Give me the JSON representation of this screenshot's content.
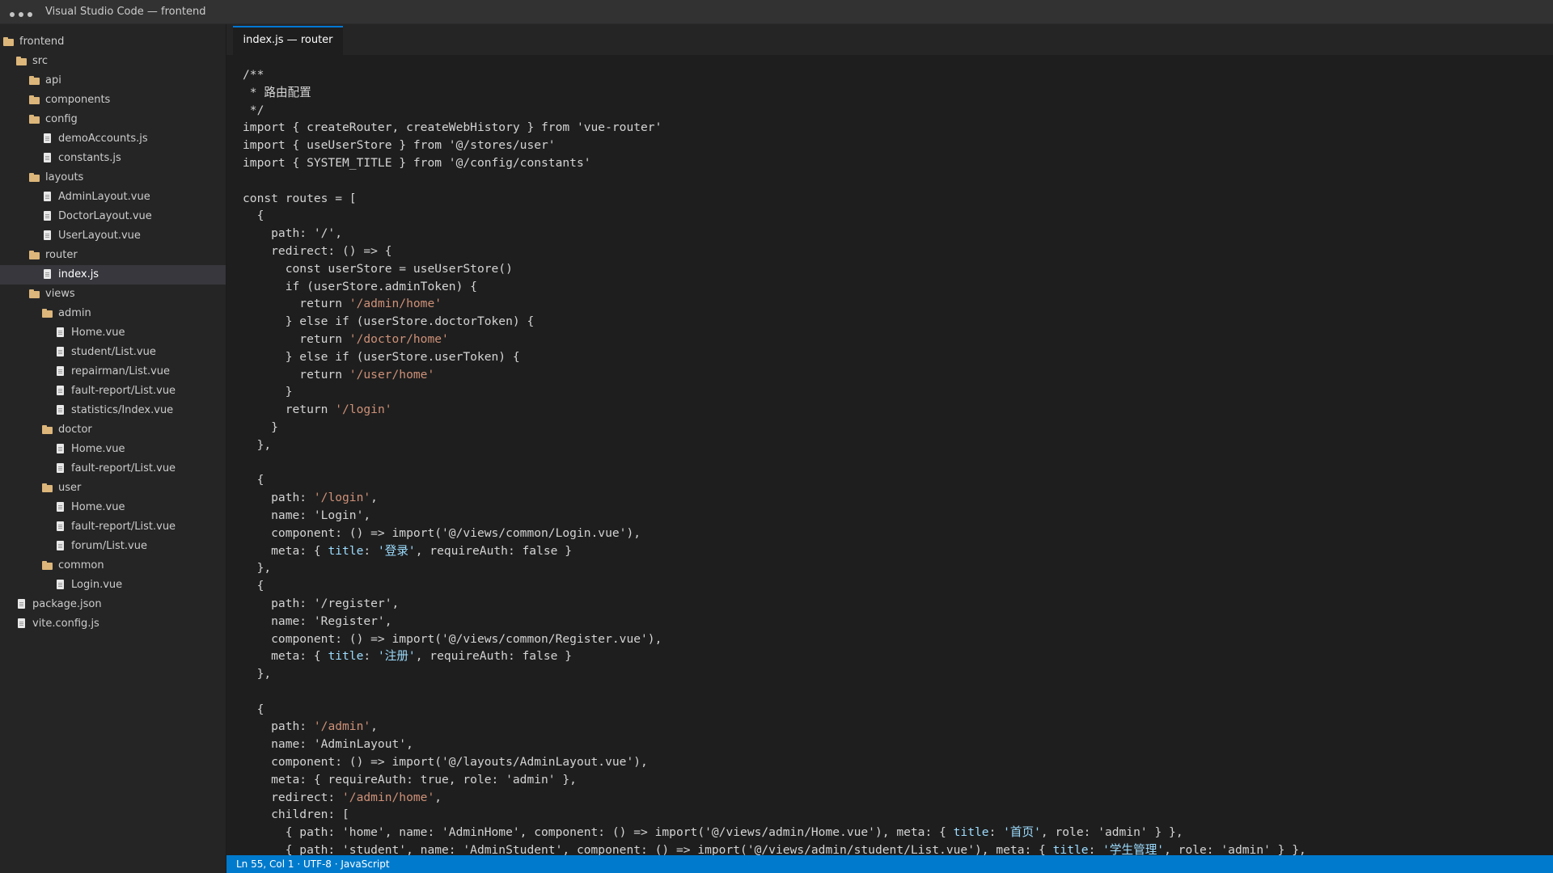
{
  "window": {
    "title": "Visual Studio Code — frontend"
  },
  "explorer": [
    {
      "label": "frontend",
      "type": "folder",
      "depth": 0,
      "active": false
    },
    {
      "label": "src",
      "type": "folder",
      "depth": 1,
      "active": false
    },
    {
      "label": "api",
      "type": "folder",
      "depth": 2,
      "active": false
    },
    {
      "label": "components",
      "type": "folder",
      "depth": 2,
      "active": false
    },
    {
      "label": "config",
      "type": "folder",
      "depth": 2,
      "active": false
    },
    {
      "label": "demoAccounts.js",
      "type": "file",
      "depth": 3,
      "active": false
    },
    {
      "label": "constants.js",
      "type": "file",
      "depth": 3,
      "active": false
    },
    {
      "label": "layouts",
      "type": "folder",
      "depth": 2,
      "active": false
    },
    {
      "label": "AdminLayout.vue",
      "type": "file",
      "depth": 3,
      "active": false
    },
    {
      "label": "DoctorLayout.vue",
      "type": "file",
      "depth": 3,
      "active": false
    },
    {
      "label": "UserLayout.vue",
      "type": "file",
      "depth": 3,
      "active": false
    },
    {
      "label": "router",
      "type": "folder",
      "depth": 2,
      "active": false
    },
    {
      "label": "index.js",
      "type": "file",
      "depth": 3,
      "active": true
    },
    {
      "label": "views",
      "type": "folder",
      "depth": 2,
      "active": false
    },
    {
      "label": "admin",
      "type": "folder",
      "depth": 3,
      "active": false
    },
    {
      "label": "Home.vue",
      "type": "file",
      "depth": 4,
      "active": false
    },
    {
      "label": "student/List.vue",
      "type": "file",
      "depth": 4,
      "active": false
    },
    {
      "label": "repairman/List.vue",
      "type": "file",
      "depth": 4,
      "active": false
    },
    {
      "label": "fault-report/List.vue",
      "type": "file",
      "depth": 4,
      "active": false
    },
    {
      "label": "statistics/Index.vue",
      "type": "file",
      "depth": 4,
      "active": false
    },
    {
      "label": "doctor",
      "type": "folder",
      "depth": 3,
      "active": false
    },
    {
      "label": "Home.vue",
      "type": "file",
      "depth": 4,
      "active": false
    },
    {
      "label": "fault-report/List.vue",
      "type": "file",
      "depth": 4,
      "active": false
    },
    {
      "label": "user",
      "type": "folder",
      "depth": 3,
      "active": false
    },
    {
      "label": "Home.vue",
      "type": "file",
      "depth": 4,
      "active": false
    },
    {
      "label": "fault-report/List.vue",
      "type": "file",
      "depth": 4,
      "active": false
    },
    {
      "label": "forum/List.vue",
      "type": "file",
      "depth": 4,
      "active": false
    },
    {
      "label": "common",
      "type": "folder",
      "depth": 3,
      "active": false
    },
    {
      "label": "Login.vue",
      "type": "file",
      "depth": 4,
      "active": false
    },
    {
      "label": "package.json",
      "type": "file",
      "depth": 1,
      "active": false
    },
    {
      "label": "vite.config.js",
      "type": "file",
      "depth": 1,
      "active": false
    }
  ],
  "tab": {
    "label": "index.js — router"
  },
  "colors": {
    "string": "#ce9178",
    "property": "#9cdcfe",
    "accent": "#0078d4",
    "statusbar": "#007acc"
  },
  "code_lines": [
    [
      {
        "t": "/**"
      }
    ],
    [
      {
        "t": " * 路由配置"
      }
    ],
    [
      {
        "t": " */"
      }
    ],
    [
      {
        "t": "import { createRouter, createWebHistory } from 'vue-router'"
      }
    ],
    [
      {
        "t": "import { useUserStore } from '@/stores/user'"
      }
    ],
    [
      {
        "t": "import { SYSTEM_TITLE } from '@/config/constants'"
      }
    ],
    [
      {
        "t": ""
      }
    ],
    [
      {
        "t": "const routes = ["
      }
    ],
    [
      {
        "t": "  {"
      }
    ],
    [
      {
        "t": "    path: '/',"
      }
    ],
    [
      {
        "t": "    redirect: () => {"
      }
    ],
    [
      {
        "t": "      const userStore = useUserStore()"
      }
    ],
    [
      {
        "t": "      if (userStore.adminToken) {"
      }
    ],
    [
      {
        "t": "        return "
      },
      {
        "t": "'/admin/home'",
        "c": "str"
      }
    ],
    [
      {
        "t": "      } else if (userStore.doctorToken) {"
      }
    ],
    [
      {
        "t": "        return "
      },
      {
        "t": "'/doctor/home'",
        "c": "str"
      }
    ],
    [
      {
        "t": "      } else if (userStore.userToken) {"
      }
    ],
    [
      {
        "t": "        return "
      },
      {
        "t": "'/user/home'",
        "c": "str"
      }
    ],
    [
      {
        "t": "      }"
      }
    ],
    [
      {
        "t": "      return "
      },
      {
        "t": "'/login'",
        "c": "str"
      }
    ],
    [
      {
        "t": "    }"
      }
    ],
    [
      {
        "t": "  },"
      }
    ],
    [
      {
        "t": ""
      }
    ],
    [
      {
        "t": "  {"
      }
    ],
    [
      {
        "t": "    path: "
      },
      {
        "t": "'/login'",
        "c": "str"
      },
      {
        "t": ","
      }
    ],
    [
      {
        "t": "    name: 'Login',"
      }
    ],
    [
      {
        "t": "    component: () => import('@/views/common/Login.vue'),"
      }
    ],
    [
      {
        "t": "    meta: { "
      },
      {
        "t": "title",
        "c": "blue"
      },
      {
        "t": ": "
      },
      {
        "t": "'登录'",
        "c": "blue"
      },
      {
        "t": ", requireAuth: false }"
      }
    ],
    [
      {
        "t": "  },"
      }
    ],
    [
      {
        "t": "  {"
      }
    ],
    [
      {
        "t": "    path: '/register',"
      }
    ],
    [
      {
        "t": "    name: 'Register',"
      }
    ],
    [
      {
        "t": "    component: () => import('@/views/common/Register.vue'),"
      }
    ],
    [
      {
        "t": "    meta: { "
      },
      {
        "t": "title",
        "c": "blue"
      },
      {
        "t": ": "
      },
      {
        "t": "'注册'",
        "c": "blue"
      },
      {
        "t": ", requireAuth: false }"
      }
    ],
    [
      {
        "t": "  },"
      }
    ],
    [
      {
        "t": ""
      }
    ],
    [
      {
        "t": "  {"
      }
    ],
    [
      {
        "t": "    path: "
      },
      {
        "t": "'/admin'",
        "c": "str"
      },
      {
        "t": ","
      }
    ],
    [
      {
        "t": "    name: 'AdminLayout',"
      }
    ],
    [
      {
        "t": "    component: () => import('@/layouts/AdminLayout.vue'),"
      }
    ],
    [
      {
        "t": "    meta: { requireAuth: true, role: 'admin' },"
      }
    ],
    [
      {
        "t": "    redirect: "
      },
      {
        "t": "'/admin/home'",
        "c": "str"
      },
      {
        "t": ","
      }
    ],
    [
      {
        "t": "    children: ["
      }
    ],
    [
      {
        "t": "      { path: 'home', name: 'AdminHome', component: () => import('@/views/admin/Home.vue'), meta: { "
      },
      {
        "t": "title",
        "c": "blue"
      },
      {
        "t": ": "
      },
      {
        "t": "'首页'",
        "c": "blue"
      },
      {
        "t": ", role: 'admin' } },"
      }
    ],
    [
      {
        "t": "      { path: 'student', name: 'AdminStudent', component: () => import('@/views/admin/student/List.vue'), meta: { "
      },
      {
        "t": "title",
        "c": "blue"
      },
      {
        "t": ": "
      },
      {
        "t": "'学生管理'",
        "c": "blue"
      },
      {
        "t": ", role: 'admin' } },"
      }
    ]
  ],
  "statusbar": {
    "text": "Ln 55, Col 1 · UTF-8 · JavaScript"
  }
}
